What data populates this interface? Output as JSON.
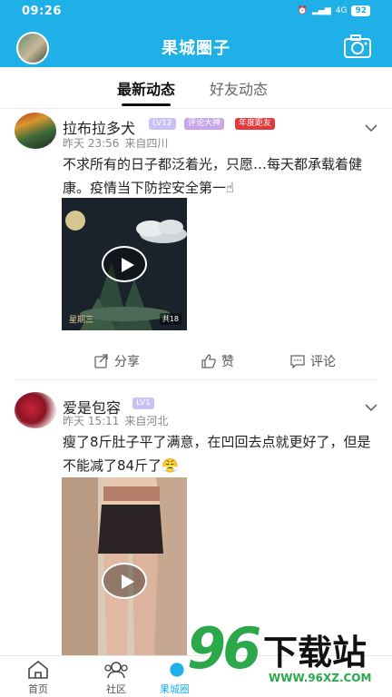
{
  "status_bar": {
    "time": "09:26",
    "network": "4G",
    "battery": "92"
  },
  "app_bar": {
    "title": "果城圈子"
  },
  "tabs": [
    {
      "label": "最新动态",
      "active": true
    },
    {
      "label": "好友动态",
      "active": false
    }
  ],
  "posts": [
    {
      "name": "拉布拉多犬",
      "badges": [
        "LV12",
        "评论大神",
        "年度距友"
      ],
      "time": "昨天 23:56",
      "location": "来自四川",
      "text": "不求所有的日子都泛着光，只愿…每天都承载着健康。疫情当下防控安全第一☝",
      "video_caption": "星期三",
      "video_counter": "共18"
    },
    {
      "name": "爱是包容",
      "badges": [
        "LV1"
      ],
      "time": "昨天 15:11",
      "location": "来自河北",
      "text": "瘦了8斤肚子平了满意，在凹回去点就更好了，但是不能减了84斤了😤"
    }
  ],
  "actions": {
    "share": "分享",
    "like": "赞",
    "comment": "评论"
  },
  "bottom_nav": [
    {
      "label": "首页",
      "icon": "home-icon"
    },
    {
      "label": "社区",
      "icon": "community-icon"
    },
    {
      "label": "果城圈子",
      "icon": "circle-icon",
      "active": true
    }
  ],
  "watermark": {
    "brand": "96",
    "text": "下载站",
    "url": "WWW.96XZ.COM"
  },
  "colors": {
    "accent": "#1fb0e8",
    "badge_red": "#e23a3a",
    "watermark_green": "#2aa84a"
  }
}
